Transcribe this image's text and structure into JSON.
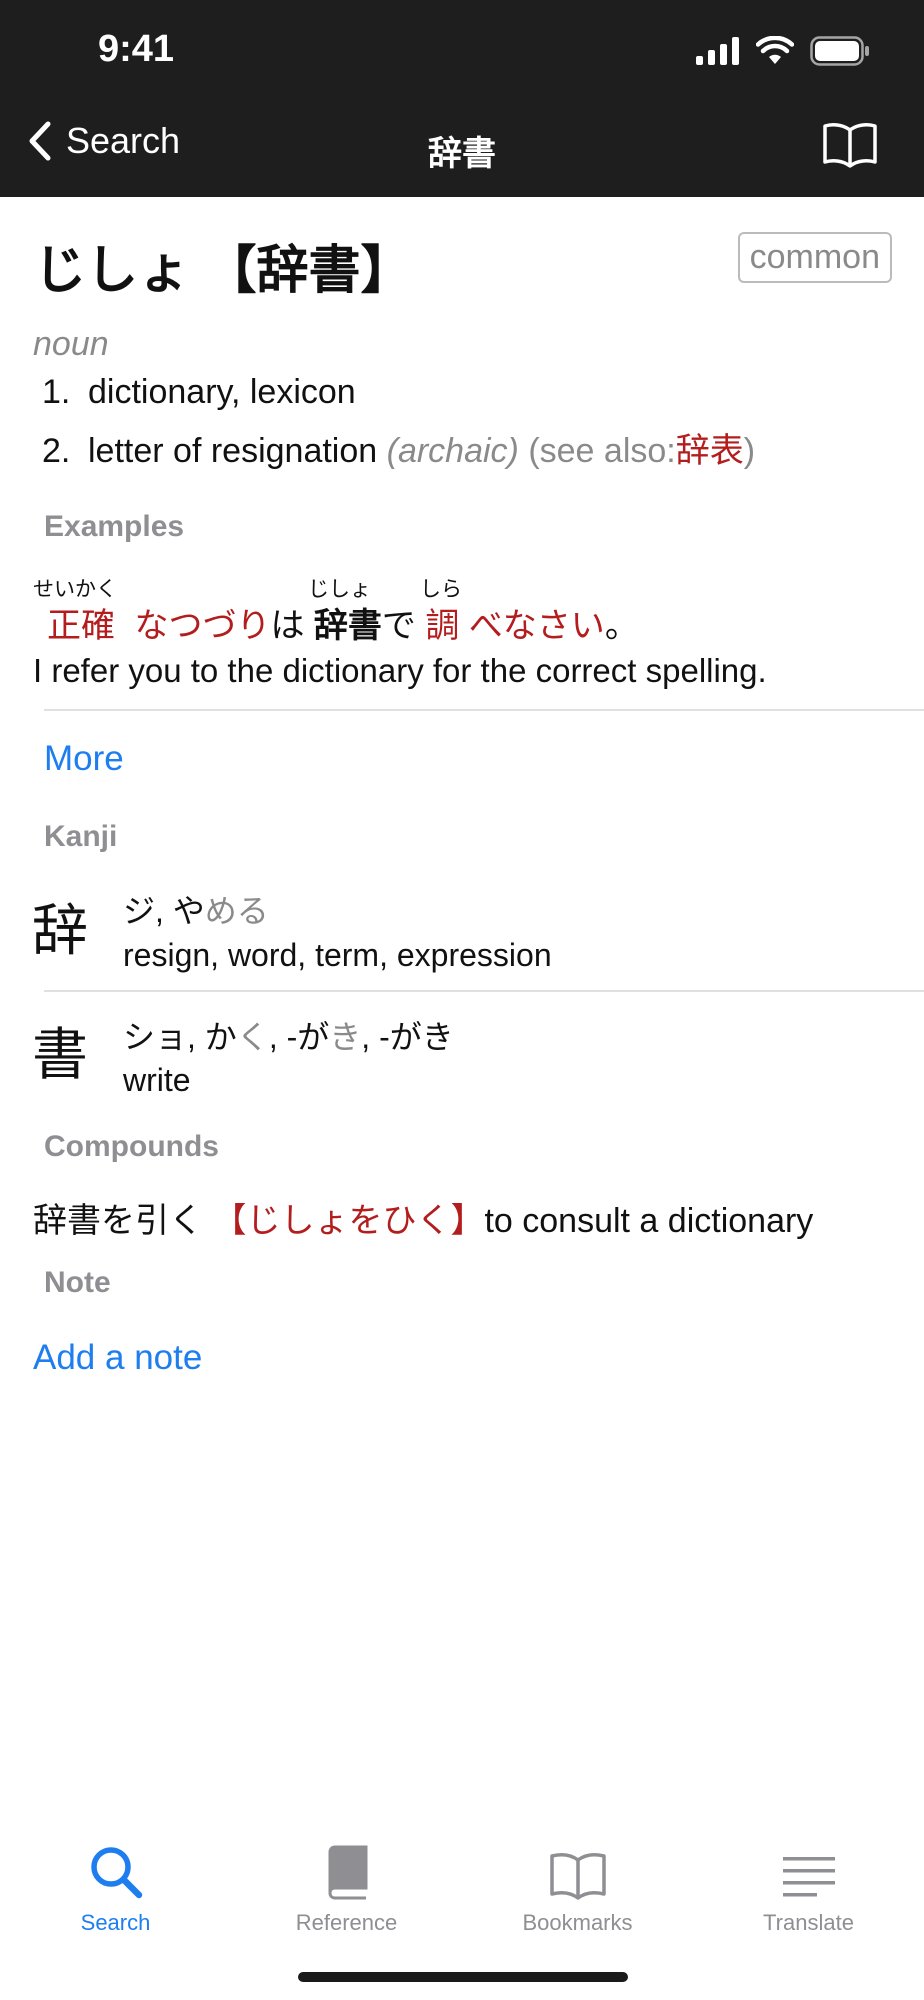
{
  "status": {
    "time": "9:41"
  },
  "nav": {
    "back_label": "Search",
    "title": "辞書"
  },
  "entry": {
    "reading": "じしょ",
    "headword": "【辞書】",
    "badge": "common",
    "pos": "noun",
    "senses": [
      {
        "num": "1.",
        "gloss": "dictionary, lexicon"
      },
      {
        "num": "2.",
        "gloss": "letter of resignation",
        "note": "(archaic)",
        "see_prefix": "(see also:",
        "see_word": "辞表",
        "see_suffix": ")"
      }
    ]
  },
  "examples": {
    "header": "Examples",
    "furigana": [
      "せいかく",
      "じしょ",
      "しら"
    ],
    "sentence": [
      "正確",
      "なつづり",
      "は",
      "辞書",
      "で",
      "調",
      "べなさい",
      "。"
    ],
    "translation": "I refer you to the dictionary for the correct spelling.",
    "more": "More"
  },
  "kanji": {
    "header": "Kanji",
    "items": [
      {
        "char": "辞",
        "on": "ジ, や",
        "okurigana": "める",
        "meaning": "resign, word, term, expression"
      },
      {
        "char": "書",
        "r1": "ショ, か",
        "o1": "く",
        "r2": ", -が",
        "o2": "き",
        "r3": ", -がき",
        "meaning": "write"
      }
    ]
  },
  "compounds": {
    "header": "Compounds",
    "items": [
      {
        "word": "辞書を引く",
        "reading": "【じしょをひく】",
        "meaning": "to consult a dictionary"
      }
    ]
  },
  "note": {
    "header": "Note",
    "add": "Add a note"
  },
  "tabs": [
    {
      "label": "Search",
      "icon": "search-icon",
      "active": true
    },
    {
      "label": "Reference",
      "icon": "reference-book-icon",
      "active": false
    },
    {
      "label": "Bookmarks",
      "icon": "bookmarks-icon",
      "active": false
    },
    {
      "label": "Translate",
      "icon": "translate-lines-icon",
      "active": false
    }
  ],
  "colors": {
    "accent": "#1e7ef0",
    "highlight": "#b31d1d",
    "secondary": "#8e8e93",
    "bar": "#1e1e1e"
  }
}
